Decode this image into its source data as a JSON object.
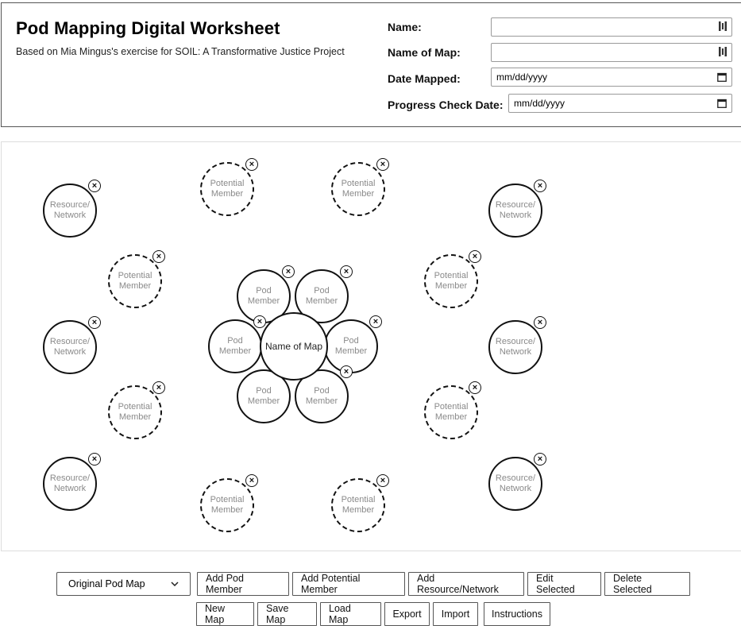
{
  "header": {
    "title": "Pod Mapping Digital Worksheet",
    "subtitle": "Based on Mia Mingus's exercise for SOIL: A Transformative Justice Project",
    "fields": {
      "name_label": "Name:",
      "name_value": "",
      "map_name_label": "Name of Map:",
      "map_name_value": "",
      "date_mapped_label": "Date Mapped:",
      "date_mapped_placeholder": "mm/dd/yyyy",
      "progress_label": "Progress Check Date:",
      "progress_placeholder": "mm/dd/yyyy"
    }
  },
  "map": {
    "center_label": "Name of Map",
    "pod_member_label": "Pod Member",
    "potential_member_label": "Potential Member",
    "resource_label": "Resource/Network",
    "close_glyph": "×"
  },
  "toolbar": {
    "map_select_value": "Original Pod Map",
    "add_pod_member": "Add Pod Member",
    "add_potential_member": "Add Potential Member",
    "add_resource": "Add Resource/Network",
    "edit_selected": "Edit Selected",
    "delete_selected": "Delete Selected",
    "new_map": "New Map",
    "save_map": "Save Map",
    "load_map": "Load Map",
    "export": "Export",
    "import": "Import",
    "instructions": "Instructions"
  },
  "icons": {
    "field_icon": "password-manager-icon",
    "calendar": "calendar-icon",
    "dropdown": "chevron-down-icon",
    "remove": "close-circle-icon"
  },
  "colors": {
    "border": "#111111",
    "placeholder_text": "#8a8a8a"
  }
}
